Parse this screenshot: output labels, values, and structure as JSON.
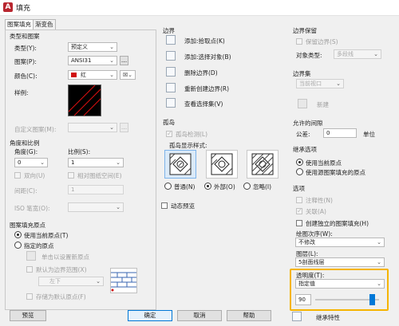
{
  "window": {
    "title": "填充",
    "app_icon_glyph": "A"
  },
  "tabs": [
    {
      "label": "图案填充"
    },
    {
      "label": "渐变色"
    }
  ],
  "type_pattern": {
    "group_title": "类型和图案",
    "type_label": "类型(Y):",
    "type_value": "预定义",
    "pattern_label": "图案(P):",
    "pattern_value": "ANSI31",
    "pattern_browse": "...",
    "color_label": "颜色(C):",
    "color_value": "红",
    "color_swatch": "#d01010",
    "sample_label": "样例:",
    "custom_label": "自定义图案(M):",
    "custom_browse": "..."
  },
  "angle_scale": {
    "group_title": "角度和比例",
    "angle_label": "角度(G):",
    "angle_value": "0",
    "scale_label": "比例(S):",
    "scale_value": "1",
    "double_label": "双向(U)",
    "relative_label": "相对图纸空间(E)",
    "spacing_label": "间距(C):",
    "spacing_value": "1",
    "iso_label": "ISO 笔宽(O):"
  },
  "origin": {
    "group_title": "图案填充原点",
    "current_label": "使用当前原点(T)",
    "specified_label": "指定的原点",
    "click_set_label": "单击以设置新原点",
    "default_extent_label": "默认为边界范围(X)",
    "extent_value": "左下",
    "store_default_label": "存储为默认原点(F)"
  },
  "boundaries": {
    "group_title": "边界",
    "add_pick_label": "添加:拾取点(K)",
    "add_select_label": "添加:选择对象(B)",
    "remove_label": "删除边界(D)",
    "recreate_label": "重新创建边界(R)",
    "view_label": "查看选择集(V)"
  },
  "islands": {
    "group_title": "孤岛",
    "detect_label": "孤岛检测(L)",
    "style_label": "孤岛显示样式:",
    "normal_label": "普通(N)",
    "outer_label": "外部(O)",
    "ignore_label": "忽略(I)"
  },
  "dynamic_preview_label": "动态预览",
  "boundary_retention": {
    "group_title": "边界保留",
    "retain_label": "保留边界(S)",
    "object_type_label": "对象类型:",
    "object_type_value": "多段线"
  },
  "boundary_set": {
    "group_title": "边界集",
    "value": "当前视口",
    "new_label": "新建"
  },
  "gap_tolerance": {
    "group_title": "允许的间隙",
    "tolerance_label": "公差:",
    "tolerance_value": "0",
    "unit_label": "单位"
  },
  "inherit": {
    "group_title": "继承选项",
    "current_origin_label": "使用当前原点",
    "source_origin_label": "使用源图案填充的原点"
  },
  "options": {
    "group_title": "选项",
    "annotative_label": "注释性(N)",
    "associative_label": "关联(A)",
    "separate_label": "创建独立的图案填充(H)",
    "draw_order_label": "绘图次序(W):",
    "draw_order_value": "不修改",
    "layer_label": "图层(L):",
    "layer_value": "5剖面线层",
    "transparency_label": "透明度(T):",
    "transparency_value": "指定值",
    "transparency_number": "90",
    "transparency_fraction": 0.9,
    "highlight_color": "#f5b400"
  },
  "footer": {
    "preview_label": "预览",
    "ok_label": "确定",
    "cancel_label": "取消",
    "help_label": "帮助",
    "collapse_glyph": "《",
    "inherit_label": "继承特性"
  }
}
